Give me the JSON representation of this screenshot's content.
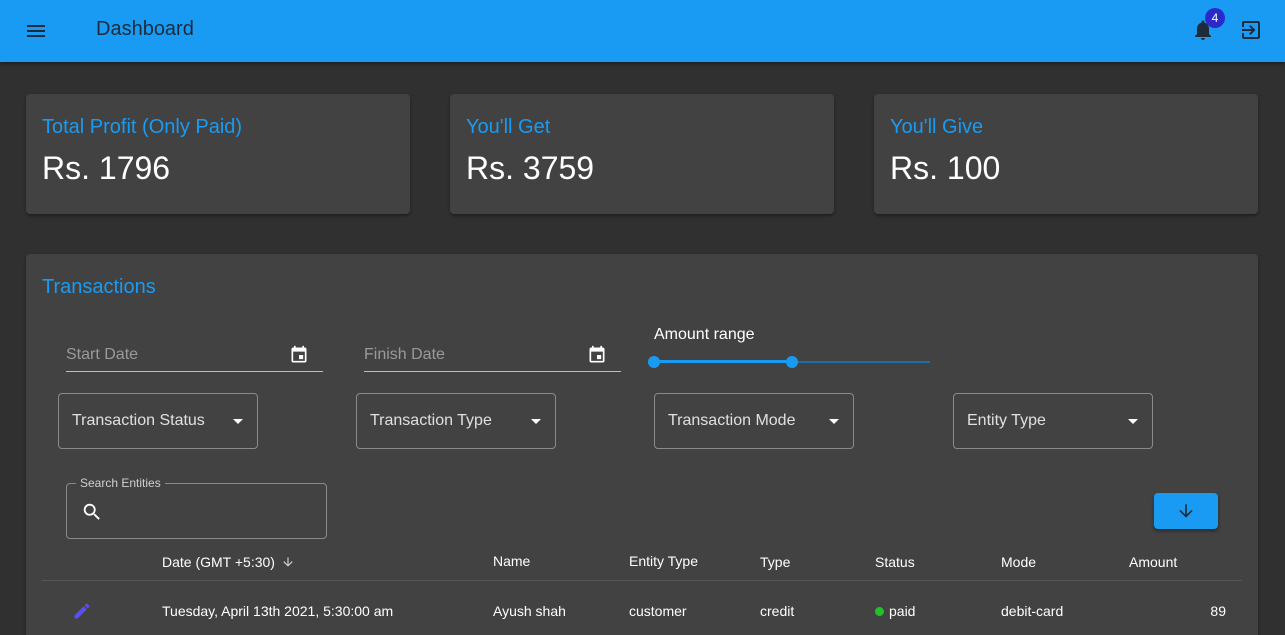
{
  "appbar": {
    "title": "Dashboard",
    "notification_count": "4",
    "menu_icon": "menu-icon",
    "bell_icon": "bell-icon",
    "logout_icon": "logout-icon"
  },
  "cards": [
    {
      "title": "Total Profit (Only Paid)",
      "value": "Rs. 1796"
    },
    {
      "title": "You'll Get",
      "value": "Rs. 3759"
    },
    {
      "title": "You'll Give",
      "value": "Rs. 100"
    }
  ],
  "transactions": {
    "title": "Transactions",
    "start_date_placeholder": "Start Date",
    "finish_date_placeholder": "Finish Date",
    "amount_range_label": "Amount range",
    "amount_range_fraction": [
      0.0,
      0.5
    ],
    "filters": [
      "Transaction Status",
      "Transaction Type",
      "Transaction Mode",
      "Entity Type"
    ],
    "search_label": "Search Entities",
    "columns": [
      "Date (GMT +5:30)",
      "Name",
      "Entity Type",
      "Type",
      "Status",
      "Mode",
      "Amount"
    ],
    "rows": [
      {
        "date": "Tuesday, April 13th 2021, 5:30:00 am",
        "name": "Ayush shah",
        "entity_type": "customer",
        "type": "credit",
        "status": "paid",
        "mode": "debit-card",
        "amount": "89"
      }
    ]
  },
  "colors": {
    "accent": "#1a9bf3",
    "background": "#303030",
    "card": "#424242",
    "status_paid": "#22c02a",
    "edit_icon": "#5b4ef0",
    "badge": "#2a2ac8"
  }
}
